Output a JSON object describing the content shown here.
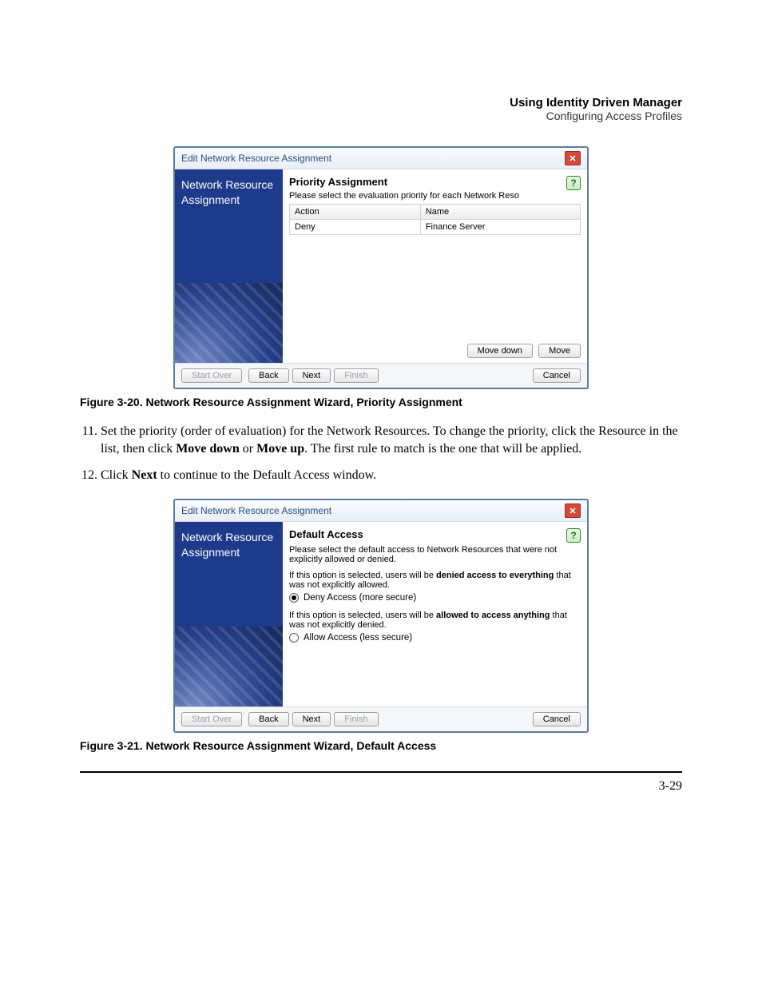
{
  "running_head": {
    "title": "Using Identity Driven Manager",
    "subtitle": "Configuring Access Profiles"
  },
  "dialog1": {
    "title": "Edit Network Resource Assignment",
    "sidebar": "Network Resource Assignment",
    "heading": "Priority Assignment",
    "hint": "Please select the evaluation priority for each Network Reso",
    "columns": {
      "c0": "Action",
      "c1": "Name"
    },
    "row0": {
      "c0": "Deny",
      "c1": "Finance Server"
    },
    "move_down": "Move down",
    "move": "Move",
    "footer": {
      "start_over": "Start Over",
      "back": "Back",
      "next": "Next",
      "finish": "Finish",
      "cancel": "Cancel"
    }
  },
  "figcap1": "Figure 3-20. Network Resource Assignment Wizard, Priority Assignment",
  "steps": {
    "s11a": "Set the priority (order of evaluation) for the Network Resources. To change the priority, click the Resource in the list, then click ",
    "s11b": "Move down",
    "s11c": " or ",
    "s11d": "Move up",
    "s11e": ". The first rule to match is the one that will be applied.",
    "s12a": "Click ",
    "s12b": "Next",
    "s12c": " to continue to the Default Access window."
  },
  "dialog2": {
    "title": "Edit Network Resource Assignment",
    "sidebar": "Network Resource Assignment",
    "heading": "Default Access",
    "para1": "Please select the default access to Network Resources that were not explicitly allowed or denied.",
    "para2a": "If this option is selected, users will be ",
    "para2b": "denied access to everything",
    "para2c": " that was not explicitly allowed.",
    "opt1": "Deny Access  (more secure)",
    "para3a": "If this option is selected, users will be ",
    "para3b": "allowed to access anything",
    "para3c": " that was not explicitly denied.",
    "opt2": "Allow Access  (less secure)",
    "footer": {
      "start_over": "Start Over",
      "back": "Back",
      "next": "Next",
      "finish": "Finish",
      "cancel": "Cancel"
    }
  },
  "figcap2": "Figure 3-21. Network Resource Assignment Wizard, Default Access",
  "pagenum": "3-29"
}
